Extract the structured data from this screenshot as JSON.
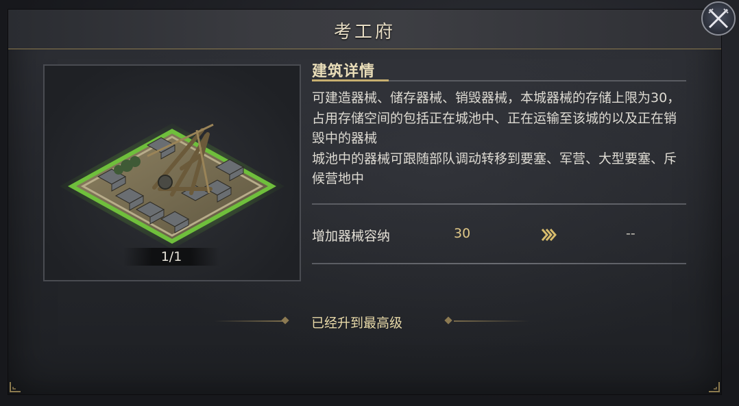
{
  "window": {
    "title": "考工府"
  },
  "building": {
    "level_text": "1/1"
  },
  "details": {
    "section_title": "建筑详情",
    "description": "可建造器械、储存器械、销毁器械，本城器械的存储上限为30，占用存储空间的包括正在城池中、正在运输至该城的以及正在销毁中的器械\n城池中的器械可跟随部队调动转移到要塞、军营、大型要塞、斥候营地中"
  },
  "stats": [
    {
      "label": "增加器械容纳",
      "current": "30",
      "next": "--"
    }
  ],
  "status": {
    "max_level_text": "已经升到最高级"
  },
  "icons": {
    "close": "crossed-swords-close-icon",
    "arrow": "triple-chevron-right-icon"
  },
  "colors": {
    "accent_gold": "#c8b070",
    "highlight_green": "#7ad04a",
    "text_light": "#dedbd3"
  }
}
